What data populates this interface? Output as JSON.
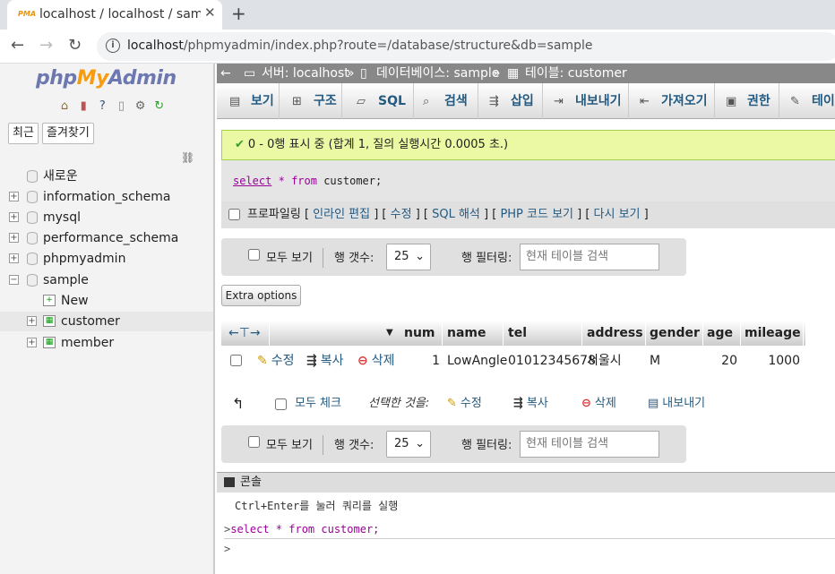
{
  "browser": {
    "tab_title": "localhost / localhost / sample",
    "tab_favicon": "PMA",
    "newtab": "+",
    "url_host": "localhost",
    "url_path": "/phpmyadmin/index.php?route=/database/structure&db=sample"
  },
  "sidebar": {
    "logo": {
      "php": "php",
      "my": "My",
      "admin": "Admin"
    },
    "recent": "최근",
    "favorites": "즐겨찾기",
    "new_db": "새로운",
    "databases": [
      "information_schema",
      "mysql",
      "performance_schema",
      "phpmyadmin",
      "sample"
    ],
    "sample_children": {
      "new": "New",
      "tables": [
        "customer",
        "member"
      ]
    }
  },
  "breadcrumb": {
    "server": "서버: localhost",
    "database": "데이터베이스: sample",
    "table": "테이블: customer",
    "sep": "»"
  },
  "menu": [
    "보기",
    "구조",
    "SQL",
    "검색",
    "삽입",
    "내보내기",
    "가져오기",
    "권한",
    "테이"
  ],
  "success_message": "0 - 0행 표시 중 (합계 1, 질의 실행시간 0.0005 초.)",
  "query": {
    "select": "select",
    "star": "*",
    "from": "from",
    "table": "customer;"
  },
  "profiling": {
    "label": "프로파일링",
    "links": [
      "인라인 편집",
      "수정",
      "SQL 해석",
      "PHP 코드 보기",
      "다시 보기"
    ]
  },
  "nav": {
    "show_all": "모두 보기",
    "rows_label": "행 갯수:",
    "rows_value": "25",
    "filter_label": "행 필터링:",
    "filter_placeholder": "현재 테이블 검색"
  },
  "extra_options": "Extra options",
  "table": {
    "columns": [
      "num",
      "name",
      "tel",
      "address",
      "gender",
      "age",
      "mileage"
    ],
    "rows": [
      {
        "edit": "수정",
        "copy": "복사",
        "delete": "삭제",
        "num": "1",
        "name": "LowAngle",
        "tel": "01012345678",
        "address": "서울시",
        "gender": "M",
        "age": "20",
        "mileage": "1000"
      }
    ]
  },
  "bulk": {
    "check_all": "모두 체크",
    "with_selected": "선택한 것을:",
    "edit": "수정",
    "copy": "복사",
    "delete": "삭제",
    "export": "내보내기"
  },
  "console": {
    "title": "콘솔",
    "hint": "Ctrl+Enter를 눌러 쿼리를 실행",
    "last_query": "select * from customer;",
    "prompt": ">"
  }
}
